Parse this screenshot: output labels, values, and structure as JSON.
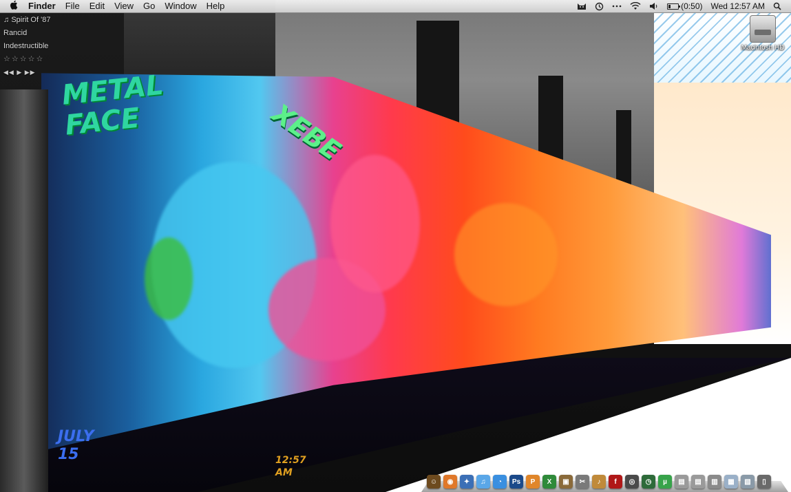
{
  "menubar": {
    "apple_glyph": "",
    "app_name": "Finder",
    "menus": [
      "File",
      "Edit",
      "View",
      "Go",
      "Window",
      "Help"
    ],
    "status": {
      "battery_text": "(0:50)",
      "battery_level": 0.2,
      "clock": "Wed 12:57 AM"
    }
  },
  "now_playing": {
    "track": "Spirit Of '87",
    "artist": "Rancid",
    "album": "Indestructible",
    "rating": "☆☆☆☆☆",
    "controls": "◀◀ ▶ ▶▶"
  },
  "desktop": {
    "hd_label": "Macintosh HD"
  },
  "wallpaper_text": {
    "tag1": "METAL FACE",
    "tag2": "XEBE",
    "tag3": "JULY 15",
    "tag4": "12:57 AM"
  },
  "dock": {
    "items": [
      {
        "name": "finder-icon",
        "glyph": "☺",
        "color": "#6d4a1e"
      },
      {
        "name": "firefox-icon",
        "glyph": "◉",
        "color": "#e0782a"
      },
      {
        "name": "safari-icon",
        "glyph": "✦",
        "color": "#3b6fb6"
      },
      {
        "name": "itunes-icon",
        "glyph": "♫",
        "color": "#5aa7e8"
      },
      {
        "name": "ichat-icon",
        "glyph": "◔",
        "color": "#3a8fe0"
      },
      {
        "name": "photoshop-icon",
        "glyph": "Ps",
        "color": "#1b4a8a"
      },
      {
        "name": "powerpoint-icon",
        "glyph": "P",
        "color": "#e0862a"
      },
      {
        "name": "excel-icon",
        "glyph": "X",
        "color": "#2f8a3a"
      },
      {
        "name": "iphoto-icon",
        "glyph": "▣",
        "color": "#8a6a3a"
      },
      {
        "name": "tools-icon",
        "glyph": "✂",
        "color": "#7a7a7a"
      },
      {
        "name": "garageband-icon",
        "glyph": "♪",
        "color": "#c08a3a"
      },
      {
        "name": "flash-icon",
        "glyph": "f",
        "color": "#b01818"
      },
      {
        "name": "dvd-icon",
        "glyph": "◎",
        "color": "#4a4a4a"
      },
      {
        "name": "time-machine-icon",
        "glyph": "◷",
        "color": "#2e6b3a"
      },
      {
        "name": "utorrent-icon",
        "glyph": "µ",
        "color": "#37a34a"
      },
      {
        "name": "doc1-icon",
        "glyph": "▤",
        "color": "#9a9a9a"
      },
      {
        "name": "doc2-icon",
        "glyph": "▤",
        "color": "#9a9a9a"
      },
      {
        "name": "doc3-icon",
        "glyph": "▥",
        "color": "#8a8a8a"
      },
      {
        "name": "folder-icon",
        "glyph": "▦",
        "color": "#9ab0c8"
      },
      {
        "name": "downloads-icon",
        "glyph": "▧",
        "color": "#8a9aa8"
      },
      {
        "name": "trash-icon",
        "glyph": "▯",
        "color": "#6a6a6a"
      }
    ]
  }
}
